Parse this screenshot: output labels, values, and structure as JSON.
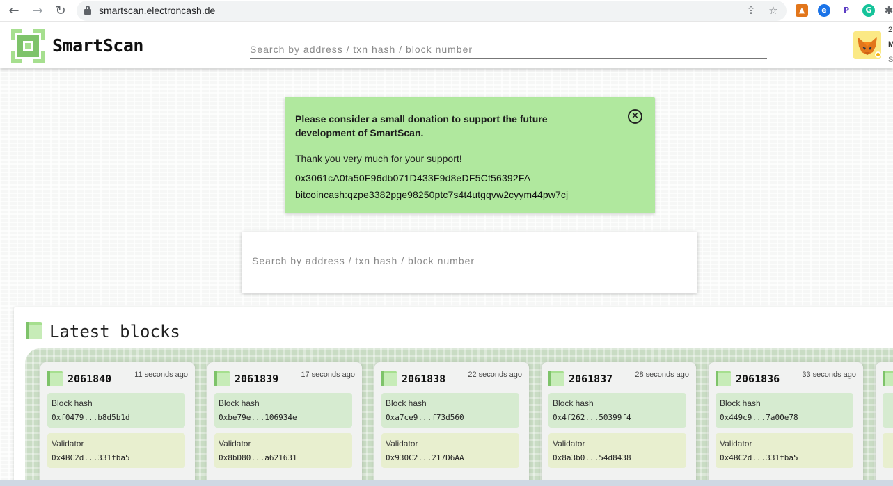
{
  "browser": {
    "url": "smartscan.electroncash.de"
  },
  "header": {
    "brand": "SmartScan",
    "search_placeholder": "Search by address / txn hash / block number",
    "account_line1": "2",
    "account_line2": "M",
    "account_line3": "S"
  },
  "donation": {
    "message": "Please consider a small donation to support the future development of SmartScan.",
    "thanks": "Thank you very much for your support!",
    "address_eth": "0x3061cA0fa50F96db071D433F9d8eDF5Cf56392FA",
    "address_bch": "bitcoincash:qzpe3382pge98250ptc7s4t4utgqvw2cyym44pw7cj",
    "close_symbol": "×"
  },
  "main_search": {
    "placeholder": "Search by address / txn hash / block number"
  },
  "latest_blocks": {
    "title": "Latest blocks",
    "hash_label": "Block hash",
    "validator_label": "Validator",
    "blocks": [
      {
        "number": "2061840",
        "age": "11 seconds ago",
        "hash": "0xf0479...b8d5b1d",
        "validator": "0x4BC2d...331fba5"
      },
      {
        "number": "2061839",
        "age": "17 seconds ago",
        "hash": "0xbe79e...106934e",
        "validator": "0x8bD80...a621631"
      },
      {
        "number": "2061838",
        "age": "22 seconds ago",
        "hash": "0xa7ce9...f73d560",
        "validator": "0x930C2...217D6AA"
      },
      {
        "number": "2061837",
        "age": "28 seconds ago",
        "hash": "0x4f262...50399f4",
        "validator": "0x8a3b0...54d8438"
      },
      {
        "number": "2061836",
        "age": "33 seconds ago",
        "hash": "0x449c9...7a00e78",
        "validator": "0x4BC2d...331fba5"
      }
    ]
  },
  "colors": {
    "accent_green": "#7ec36a",
    "donation_bg": "#b0e89e",
    "hash_box_bg": "#d6ebd0",
    "validator_box_bg": "#e8efcf"
  }
}
